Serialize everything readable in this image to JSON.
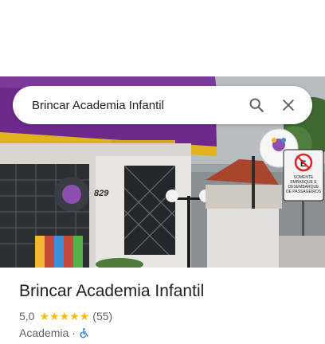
{
  "search": {
    "query": "Brincar Academia Infantil",
    "search_icon": "search-icon",
    "close_icon": "close-icon"
  },
  "photo": {
    "house_number": "829",
    "sign_text": "SOMENTE EMBARQUE E DESEMBARQUE DE PASSAGEIROS"
  },
  "place": {
    "title": "Brincar Academia Infantil",
    "rating": "5,0",
    "stars": 5,
    "review_count": "(55)",
    "category": "Academia",
    "separator": "·",
    "accessibility_icon": "wheelchair-icon"
  },
  "colors": {
    "star": "#fbbc04",
    "accessibility": "#1a73e8",
    "text_primary": "#202124",
    "text_secondary": "#5f6368"
  }
}
